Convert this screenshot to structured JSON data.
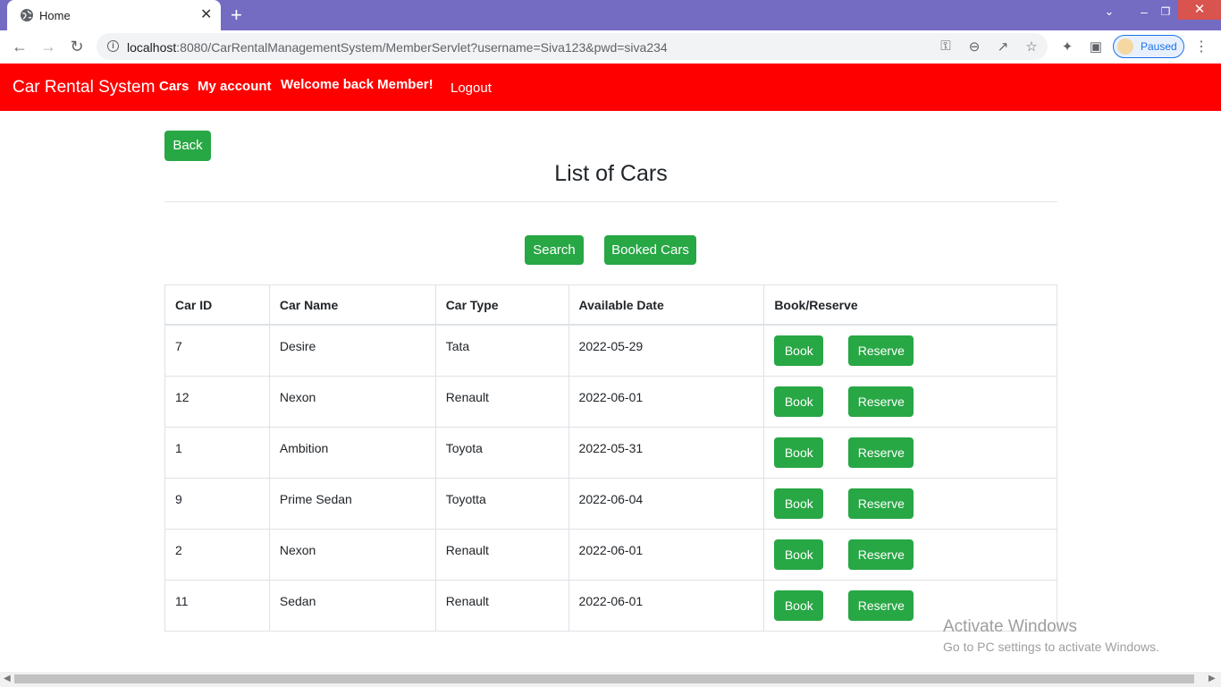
{
  "browser": {
    "tab_title": "Home",
    "tab_close": "✕",
    "new_tab": "+",
    "url_host": "localhost",
    "url_rest": ":8080/CarRentalManagementSystem/MemberServlet?username=Siva123&pwd=siva234",
    "profile_label": "Paused"
  },
  "navbar": {
    "brand": "Car Rental System",
    "links": [
      "Cars",
      "My account",
      "Welcome back Member!"
    ],
    "logout": "Logout",
    "color": "#ff0000"
  },
  "main": {
    "back_label": "Back",
    "title": "List of Cars",
    "search_label": "Search",
    "booked_label": "Booked Cars",
    "button_color": "#28a745"
  },
  "table": {
    "headers": [
      "Car ID",
      "Car Name",
      "Car Type",
      "Available Date",
      "Book/Reserve"
    ],
    "rows": [
      {
        "id": "7",
        "name": "Desire",
        "type": "Tata",
        "date": "2022-05-29"
      },
      {
        "id": "12",
        "name": "Nexon",
        "type": "Renault",
        "date": "2022-06-01"
      },
      {
        "id": "1",
        "name": "Ambition",
        "type": "Toyota",
        "date": "2022-05-31"
      },
      {
        "id": "9",
        "name": "Prime Sedan",
        "type": "Toyotta",
        "date": "2022-06-04"
      },
      {
        "id": "2",
        "name": "Nexon",
        "type": "Renault",
        "date": "2022-06-01"
      },
      {
        "id": "11",
        "name": "Sedan",
        "type": "Renault",
        "date": "2022-06-01"
      }
    ],
    "book_label": "Book",
    "reserve_label": "Reserve"
  },
  "watermark": {
    "line1": "Activate Windows",
    "line2": "Go to PC settings to activate Windows."
  }
}
